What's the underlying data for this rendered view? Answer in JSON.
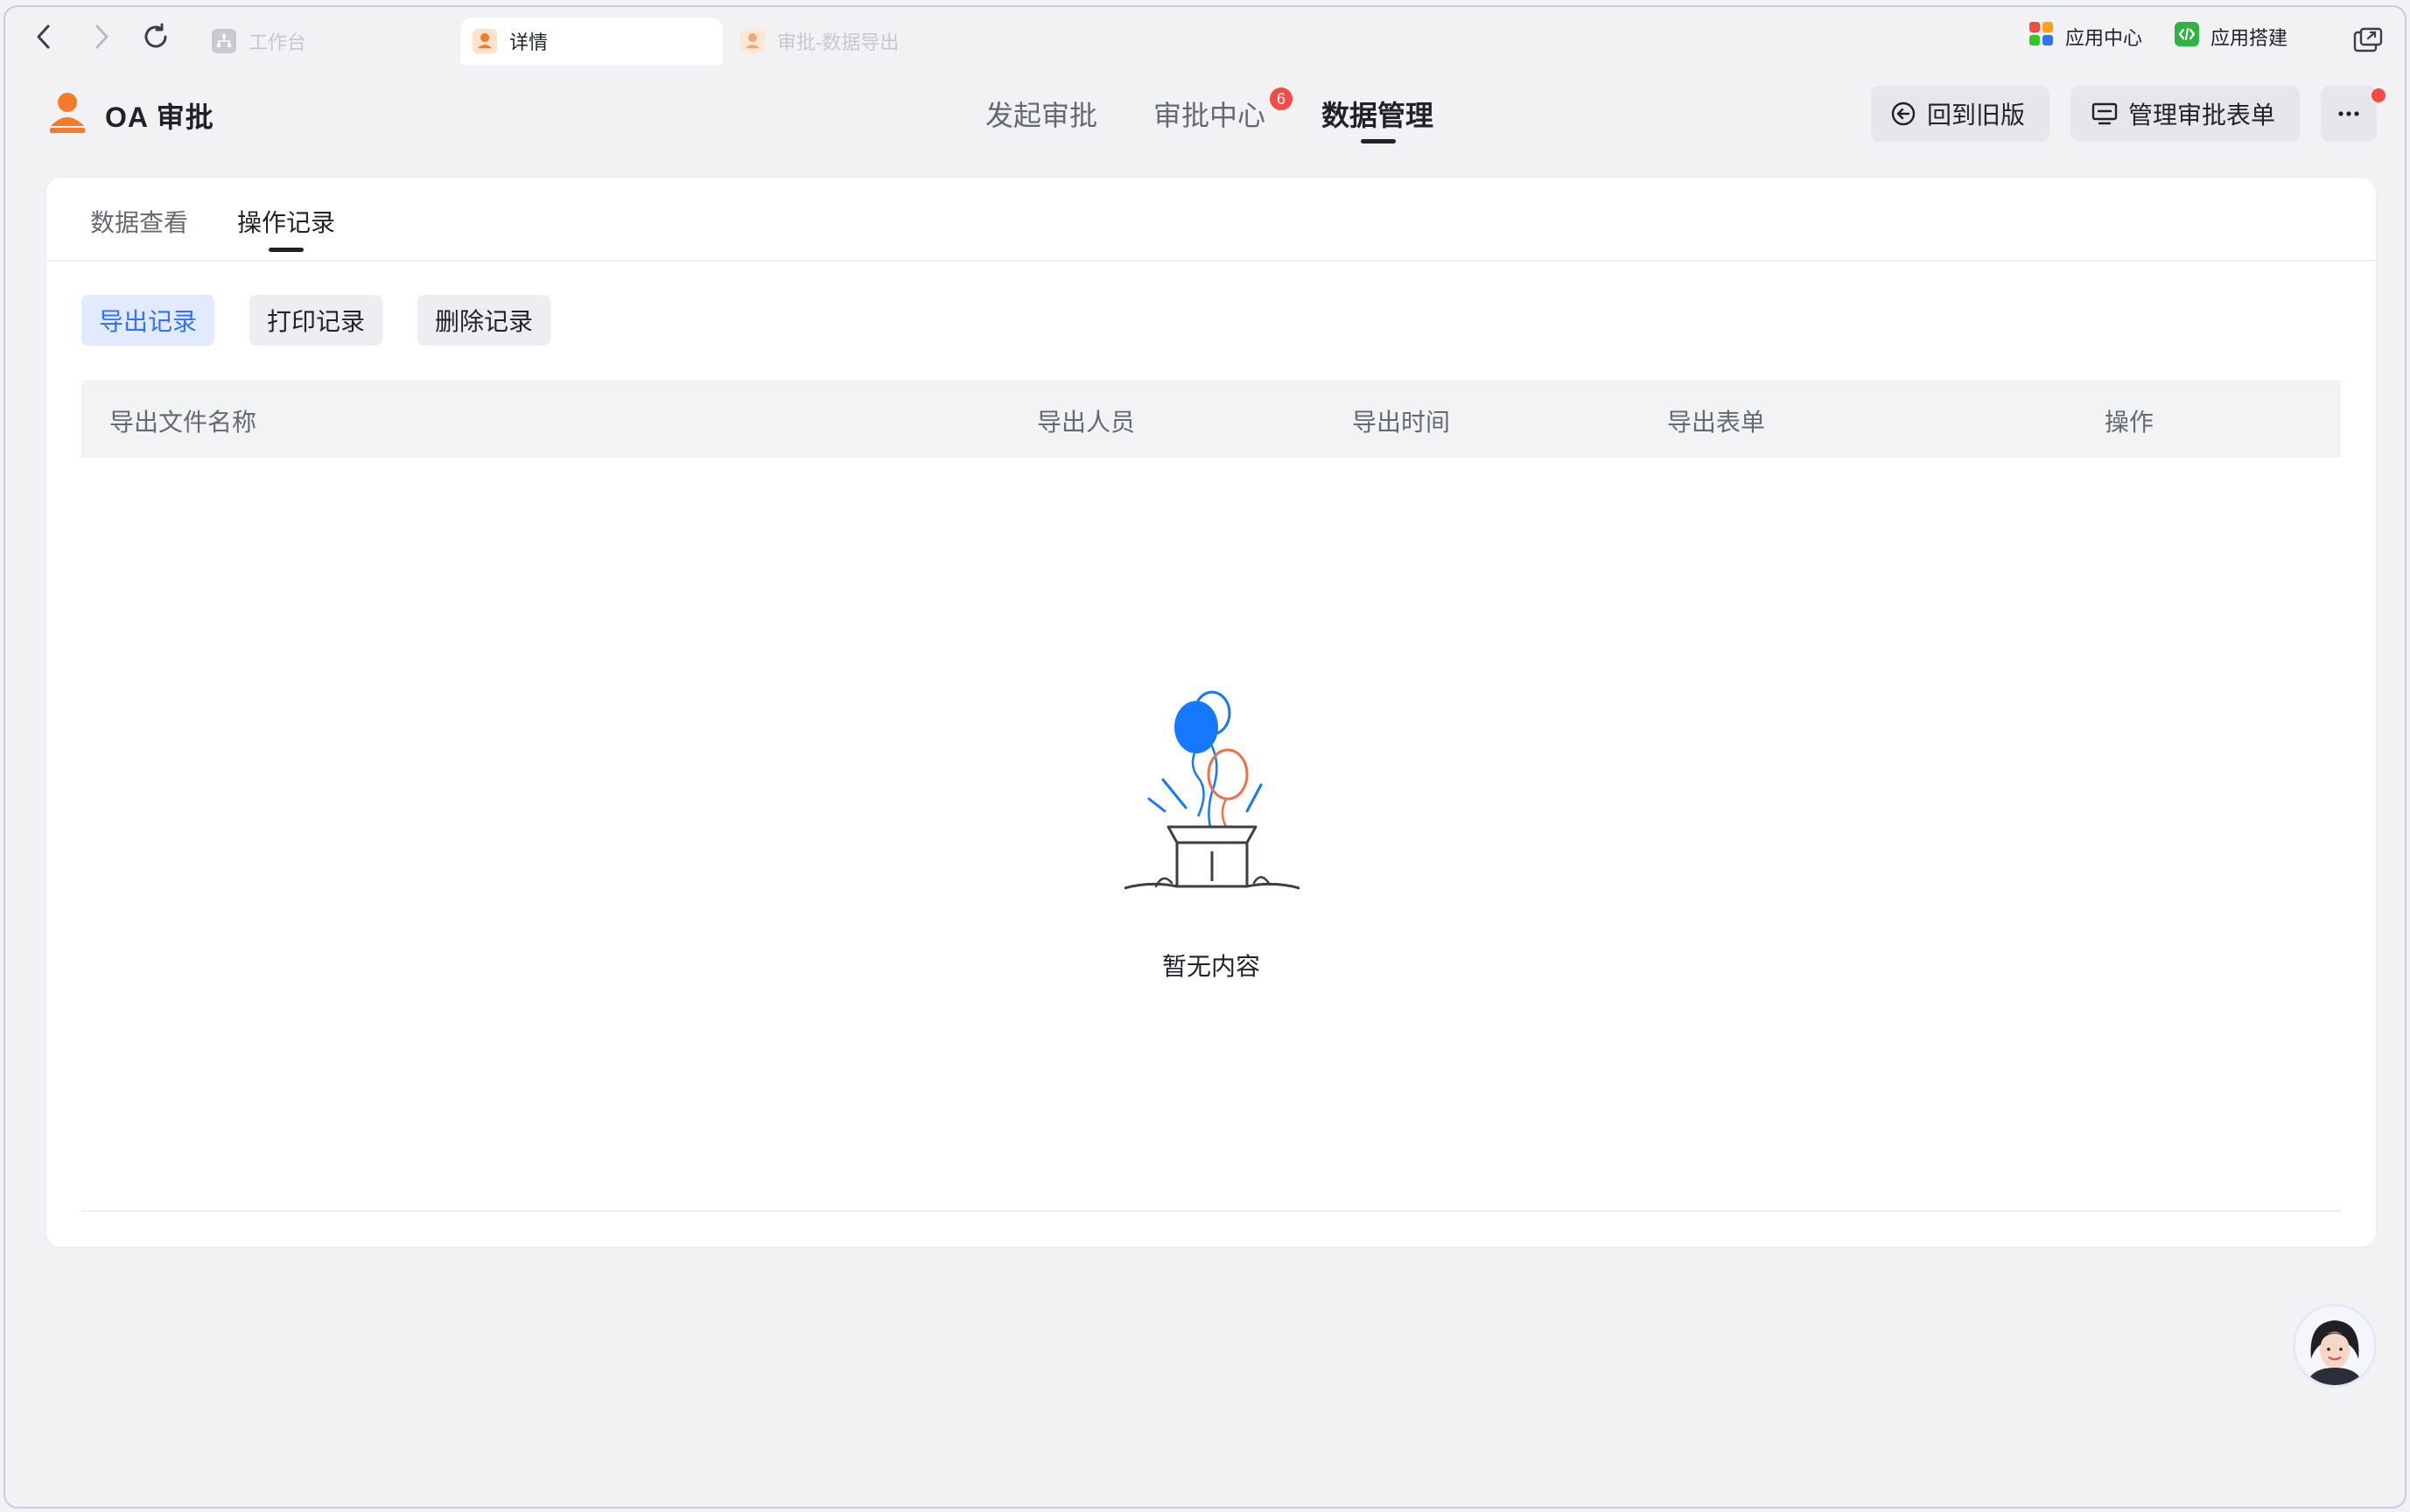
{
  "browser": {
    "tabs": [
      {
        "label": "工作台"
      },
      {
        "label": "详情"
      },
      {
        "label": "审批-数据导出"
      }
    ],
    "links": [
      {
        "label": "应用中心"
      },
      {
        "label": "应用搭建"
      }
    ]
  },
  "header": {
    "app_title": "OA 审批",
    "nav": [
      {
        "label": "发起审批"
      },
      {
        "label": "审批中心",
        "badge": "6"
      },
      {
        "label": "数据管理"
      }
    ],
    "buttons": {
      "back_old": "回到旧版",
      "manage_forms": "管理审批表单"
    }
  },
  "subtabs": [
    {
      "label": "数据查看"
    },
    {
      "label": "操作记录"
    }
  ],
  "record_types": [
    {
      "label": "导出记录"
    },
    {
      "label": "打印记录"
    },
    {
      "label": "删除记录"
    }
  ],
  "table": {
    "columns": [
      "导出文件名称",
      "导出人员",
      "导出时间",
      "导出表单",
      "操作"
    ],
    "rows": []
  },
  "empty_state": {
    "text": "暂无内容"
  },
  "colors": {
    "accent": "#3370ff",
    "badge": "#f54a45",
    "balloon_blue": "#1677ff",
    "balloon_orange": "#f0704a"
  }
}
